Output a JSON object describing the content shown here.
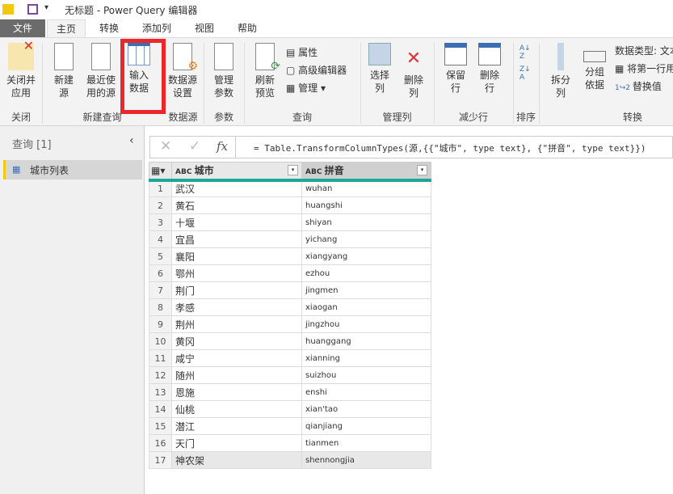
{
  "title": {
    "text": "无标题 - Power Query 编辑器"
  },
  "tabs": [
    "文件",
    "主页",
    "转换",
    "添加列",
    "视图",
    "帮助"
  ],
  "ribbon": {
    "close_apply": "关闭并\n应用",
    "new_source": "新建\n源",
    "recent_sources": "最近使\n用的源",
    "enter_data": "输入\n数据",
    "data_source_settings": "数据源\n设置",
    "manage_params": "管理\n参数",
    "refresh_preview": "刷新\n预览",
    "properties": "属性",
    "advanced_editor": "高级编辑器",
    "manage": "管理",
    "choose_columns": "选择\n列",
    "remove_columns": "删除\n列",
    "keep_rows": "保留\n行",
    "remove_rows": "删除\n行",
    "split_column": "拆分\n列",
    "group_by": "分组\n依据",
    "data_type": "数据类型: 文本",
    "first_row_header": "将第一行用作标题",
    "replace_values": "替换值",
    "groups": {
      "close": "关闭",
      "new_query": "新建查询",
      "data_source": "数据源",
      "params": "参数",
      "query": "查询",
      "manage_cols": "管理列",
      "reduce_rows": "减少行",
      "sort": "排序",
      "transform": "转换"
    }
  },
  "queries": {
    "header": "查询 [1]",
    "items": [
      "城市列表"
    ]
  },
  "formula": "= Table.TransformColumnTypes(源,{{\"城市\", type text}, {\"拼音\", type text}})",
  "table": {
    "columns": [
      "城市",
      "拼音"
    ],
    "rows": [
      [
        "武汉",
        "wuhan"
      ],
      [
        "黄石",
        "huangshi"
      ],
      [
        "十堰",
        "shiyan"
      ],
      [
        "宜昌",
        "yichang"
      ],
      [
        "襄阳",
        "xiangyang"
      ],
      [
        "鄂州",
        "ezhou"
      ],
      [
        "荆门",
        "jingmen"
      ],
      [
        "孝感",
        "xiaogan"
      ],
      [
        "荆州",
        "jingzhou"
      ],
      [
        "黄冈",
        "huanggang"
      ],
      [
        "咸宁",
        "xianning"
      ],
      [
        "随州",
        "suizhou"
      ],
      [
        "恩施",
        "enshi"
      ],
      [
        "仙桃",
        "xian'tao"
      ],
      [
        "潜江",
        "qianjiang"
      ],
      [
        "天门",
        "tianmen"
      ],
      [
        "神农架",
        "shennongjia"
      ]
    ]
  }
}
